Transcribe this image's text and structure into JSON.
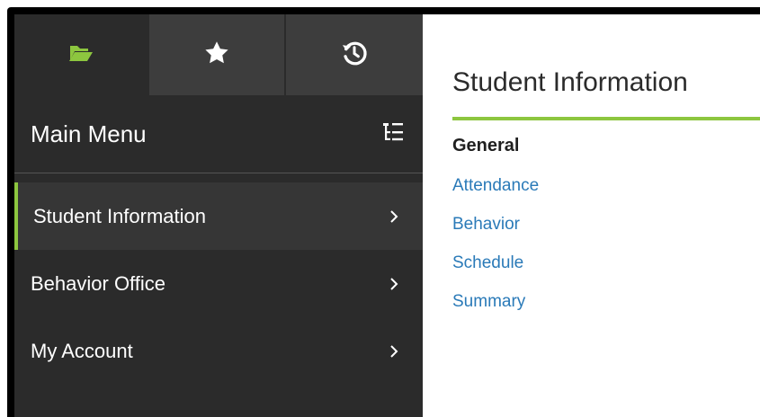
{
  "colors": {
    "accent": "#8dc63f",
    "sidebar_bg": "#2b2b2b",
    "tab_inactive_bg": "#3d3d3d",
    "link": "#2a7ab8"
  },
  "top_tabs": [
    {
      "icon": "folder-open-icon",
      "active": true
    },
    {
      "icon": "star-icon",
      "active": false
    },
    {
      "icon": "history-icon",
      "active": false
    }
  ],
  "sidebar": {
    "title": "Main Menu",
    "header_icon": "tree-list-icon",
    "items": [
      {
        "label": "Student Information",
        "active": true
      },
      {
        "label": "Behavior Office",
        "active": false
      },
      {
        "label": "My Account",
        "active": false
      }
    ]
  },
  "content": {
    "title": "Student Information",
    "group_heading": "General",
    "links": [
      "Attendance",
      "Behavior",
      "Schedule",
      "Summary"
    ]
  }
}
